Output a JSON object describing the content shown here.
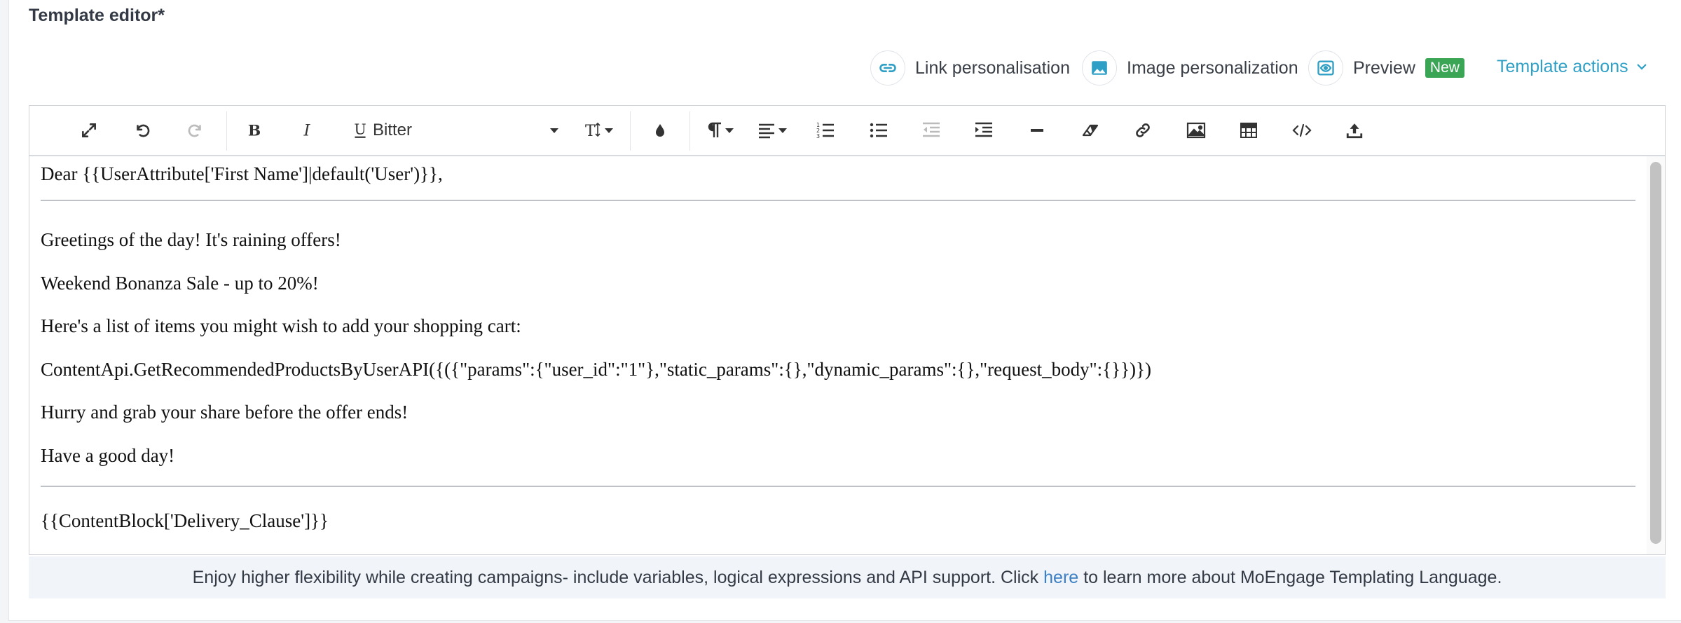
{
  "editor": {
    "title": "Template editor*"
  },
  "actions": {
    "link_personalisation": "Link personalisation",
    "image_personalization": "Image personalization",
    "preview": "Preview",
    "preview_badge": "New",
    "template_actions": "Template actions"
  },
  "toolbar": {
    "font_family": "Bitter",
    "icons": [
      "fullscreen-icon",
      "undo-icon",
      "redo-icon",
      "bold-icon",
      "italic-icon",
      "underline-icon",
      "font-size-icon",
      "text-color-icon",
      "paragraph-icon",
      "align-icon",
      "ordered-list-icon",
      "unordered-list-icon",
      "outdent-icon",
      "indent-icon",
      "horizontal-rule-icon",
      "clear-format-icon",
      "link-icon",
      "image-icon",
      "table-icon",
      "code-view-icon",
      "upload-icon"
    ]
  },
  "content": {
    "line1": "Dear {{UserAttribute['First Name']|default('User')}},",
    "line2": "Greetings of the day! It's raining offers!",
    "line3": "Weekend Bonanza Sale - up to 20%!",
    "line4": "Here's a list of items you might wish to add your shopping cart:",
    "line5": "ContentApi.GetRecommendedProductsByUserAPI({({\"params\":{\"user_id\":\"1\"},\"static_params\":{},\"dynamic_params\":{},\"request_body\":{}})})",
    "line6": "Hurry and grab your share before the offer ends!",
    "line7": "Have a good day!",
    "line8": "{{ContentBlock['Delivery_Clause']}}"
  },
  "footer": {
    "text_before": "Enjoy higher flexibility while creating campaigns- include variables, logical expressions and API support. Click",
    "link": "here",
    "text_after": "to learn more about MoEngage Templating Language."
  },
  "colors": {
    "accent": "#2f9fc5",
    "badge": "#3aa655",
    "link": "#3b7fc4"
  }
}
